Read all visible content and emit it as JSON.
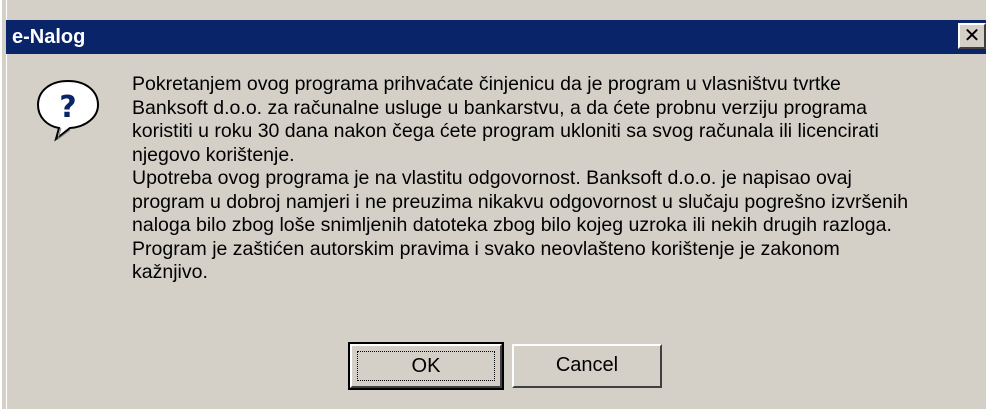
{
  "window": {
    "title": "e-Nalog",
    "close_glyph": "✕"
  },
  "icon": {
    "name": "question-icon",
    "glyph": "?",
    "color": "#0a246a"
  },
  "message": {
    "paragraph1": "Pokretanjem ovog programa prihvaćate činjenicu da je program u vlasništvu tvrtke\nBanksoft d.o.o. za računalne usluge u bankarstvu, a da ćete probnu verziju programa\nkoristiti u roku 30 dana nakon čega ćete program ukloniti sa svog računala ili licencirati\nnjegovo korištenje.",
    "paragraph2": "Upotreba ovog programa je na vlastitu odgovornost. Banksoft d.o.o. je napisao ovaj\nprogram u dobroj namjeri i ne preuzima nikakvu odgovornost u slučaju pogrešno izvršenih\nnaloga bilo zbog loše snimljenih datoteka zbog bilo kojeg uzroka ili nekih drugih razloga.",
    "paragraph3": "Program je zaštićen autorskim pravima i svako neovlašteno korištenje je zakonom\nkažnjivo."
  },
  "buttons": {
    "ok_label": "OK",
    "cancel_label": "Cancel"
  },
  "colors": {
    "title_bar": "#0a246a",
    "dialog_face": "#d4d0c8"
  }
}
